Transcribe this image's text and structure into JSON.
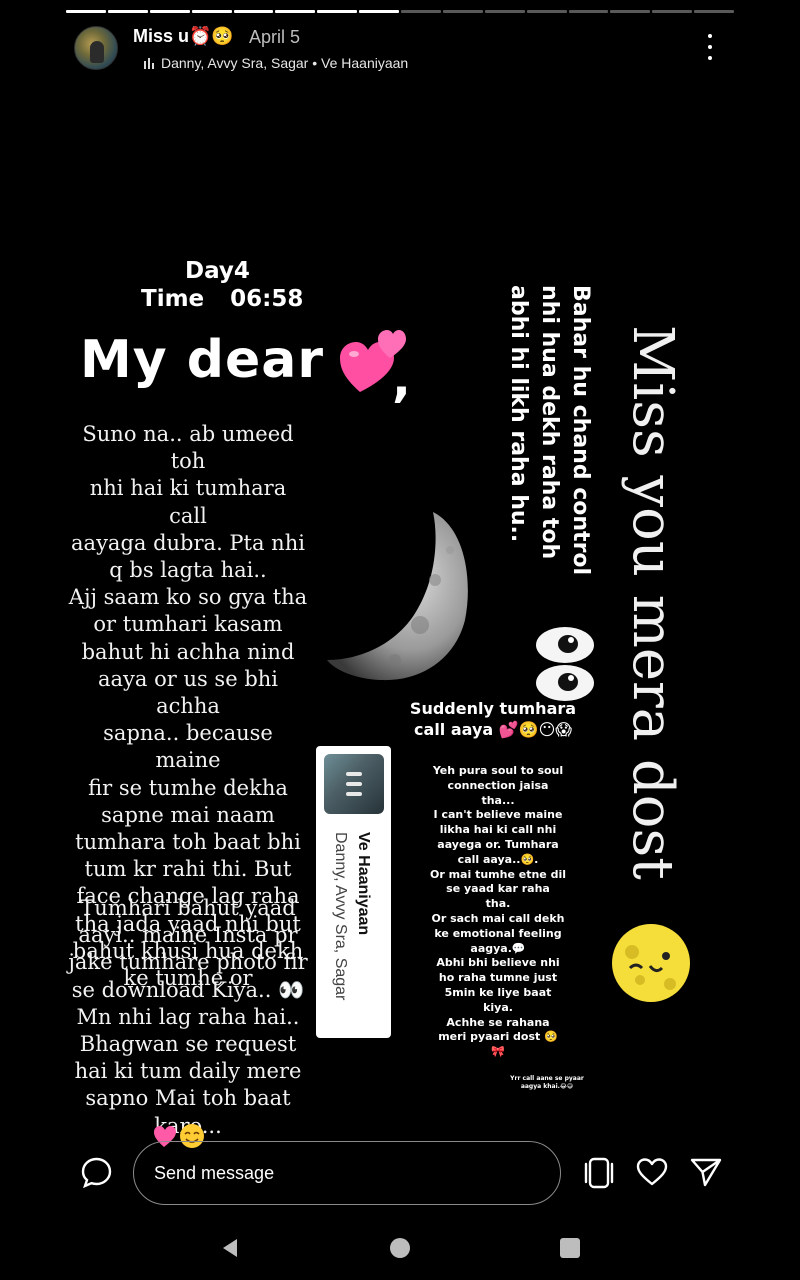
{
  "story": {
    "progress_segments": 16,
    "progress_done": 8
  },
  "header": {
    "username": "Miss u⏰🥺",
    "date": "April 5",
    "music": "Danny, Avvy Sra, Sagar • Ve Haaniyaan"
  },
  "content": {
    "day": "Day4",
    "time": "Time 06:58",
    "greeting": "My dear",
    "paragraph1": "Suno na.. ab umeed toh\nnhi hai ki tumhara call\naayaga dubra. Pta nhi\nq bs lagta hai..\nAjj saam ko so gya tha\nor tumhari kasam\nbahut hi achha nind\naaya or us se bhi achha\nsapna.. because maine\nfir se tumhe dekha\nsapne mai naam\ntumhara toh baat bhi\ntum kr rahi thi. But\nface change lag raha\ntha jada yaad nhi but\nbahut khusi hua dekh\nke tumhe or",
    "paragraph2": "Tumhari bahut yaad\naayi.. maine Insta pr\njake tumhare photo fir\nse download Kiya.. 👀\nMn nhi lag raha hai..\nBhagwan se request\nhai ki tum daily mere\nsapno Mai toh baat\nkaro...",
    "miss_you": "Miss you mera dost",
    "bahar": "Bahar hu chand control nhi hua dekh raha toh abhi hi likh raha hu..",
    "suddenly": "Suddenly tumhara call aaya 💕🥺😶😱",
    "soul_text": "Yeh pura soul to soul\nconnection jaisa\ntha...\nI can't believe maine\nlikha hai ki call nhi\naayega or. Tumhara\ncall aaya..🥺.\nOr mai tumhe etne dil\nse yaad kar raha\ntha.\nOr sach mai call dekh\nke emotional feeling\naagya.💬\nAbhi bhi believe nhi\nho raha tumne just\n5min ke liye baat\nkiya.\nAchhe se rahana\nmeri pyaari dost 🥺\n🎀",
    "tiny_text": "Yrr call aane se pyaar aagya khai.😂😅"
  },
  "music_card": {
    "title": "Ve Haaniyaan",
    "artist": "Danny, Avvy Sra, Sagar"
  },
  "bottom_bar": {
    "message_placeholder": "Send message",
    "icons": [
      "chat-bubble-icon",
      "sticker-icon",
      "heart-icon",
      "send-icon"
    ]
  },
  "nav": {
    "icons": [
      "back-icon",
      "home-icon",
      "recents-icon"
    ]
  }
}
